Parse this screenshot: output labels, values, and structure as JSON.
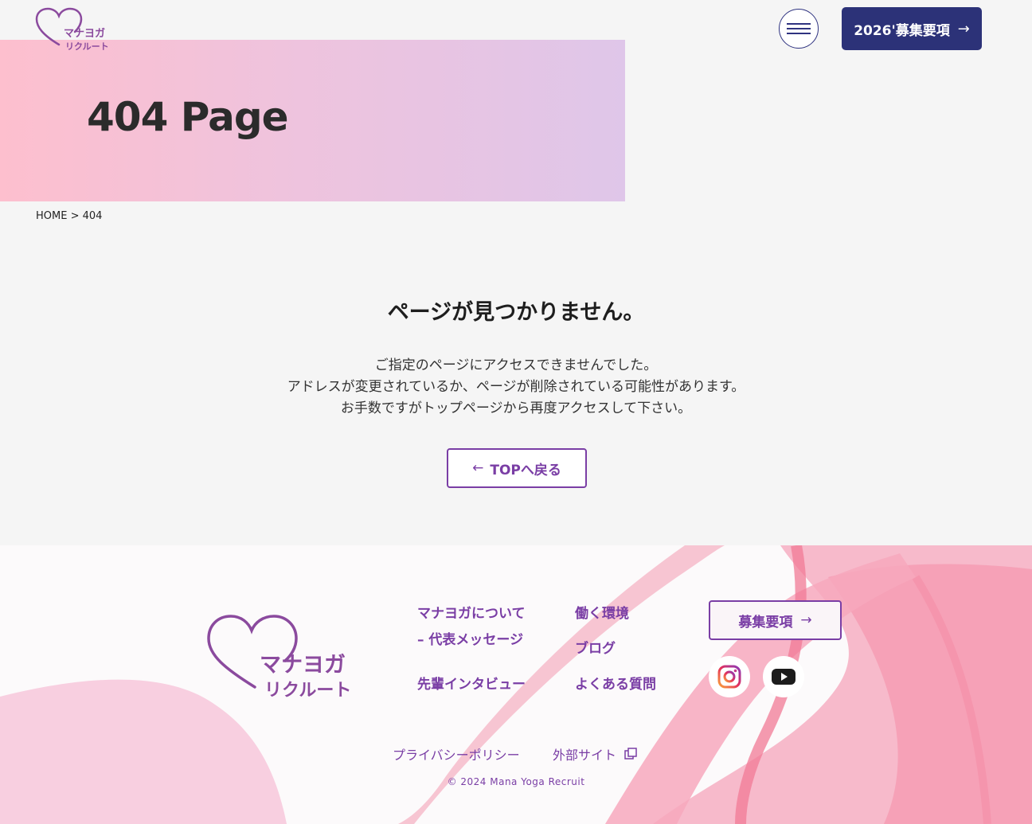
{
  "header": {
    "logo_line1": "マナヨガ",
    "logo_line2": "リクルート",
    "recruit_button": "2026'募集要項",
    "arrow": "→"
  },
  "hero": {
    "title": "404 Page"
  },
  "breadcrumb": {
    "home": "HOME",
    "separator": ">",
    "current": "404"
  },
  "main": {
    "heading": "ページが見つかりません。",
    "lines": [
      "ご指定のページにアクセスできませんでした。",
      "アドレスが変更されているか、ページが削除されている可能性があります。",
      "お手数ですがトップページから再度アクセスして下さい。"
    ],
    "back_arrow": "←",
    "back_button": "TOPへ戻る"
  },
  "footer": {
    "logo_line1": "マナヨガ",
    "logo_line2": "リクルート",
    "nav": {
      "about": "マナヨガについて",
      "message": "– 代表メッセージ",
      "interview": "先輩インタビュー",
      "environment": "働く環境",
      "blog": "ブログ",
      "faq": "よくある質問"
    },
    "recruit_button": "募集要項",
    "arrow": "→",
    "privacy": "プライバシーポリシー",
    "external": "外部サイト",
    "copyright": "© 2024 Mana Yoga Recruit"
  },
  "colors": {
    "navy": "#2c3278",
    "purple": "#7a3ea5",
    "pink": "#f58aa4",
    "hero_start": "#fdbfce",
    "hero_end": "#dfc6e9"
  },
  "icons": [
    "heart-logo-icon",
    "hamburger-icon",
    "arrow-right-icon",
    "arrow-left-icon",
    "instagram-icon",
    "youtube-icon",
    "external-link-icon"
  ]
}
